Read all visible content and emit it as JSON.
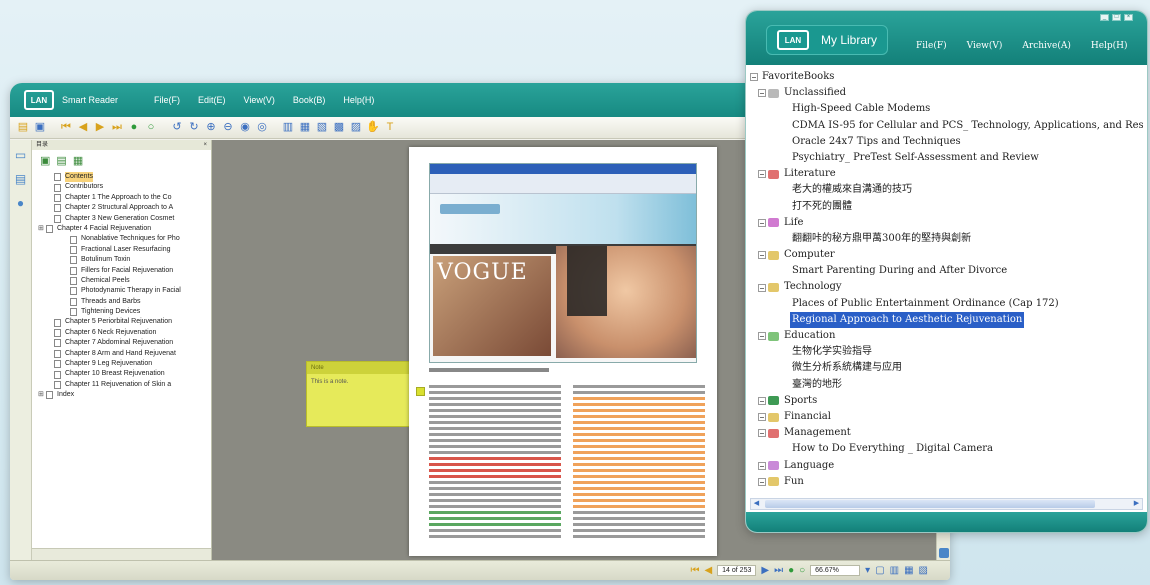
{
  "reader": {
    "app_title": "Smart Reader",
    "menus": [
      "File(F)",
      "Edit(E)",
      "View(V)",
      "Book(B)",
      "Help(H)"
    ],
    "toolbar_icons": [
      "open-icon",
      "save-icon",
      "first-page-icon",
      "prev-page-icon",
      "next-page-icon",
      "last-page-icon",
      "go-icon",
      "stop-icon",
      "rotate-left-icon",
      "rotate-right-icon",
      "zoom-in-icon",
      "zoom-out-icon",
      "zoom-fit-icon",
      "zoom-actual-icon",
      "single-page-icon",
      "two-page-icon",
      "continuous-icon",
      "print-icon",
      "bookmark-icon",
      "hand-tool-icon",
      "text-tool-icon"
    ],
    "toc_title": "目录",
    "toc": [
      {
        "label": "Contents",
        "selected": true,
        "expandable": false,
        "indent": 0
      },
      {
        "label": "Contributors",
        "selected": false,
        "expandable": false,
        "indent": 0
      },
      {
        "label": "Chapter 1 The Approach to the Co",
        "selected": false,
        "expandable": false,
        "indent": 0
      },
      {
        "label": "Chapter 2 Structural Approach to A",
        "selected": false,
        "expandable": false,
        "indent": 0
      },
      {
        "label": "Chapter 3 New Generation Cosmet",
        "selected": false,
        "expandable": false,
        "indent": 0
      },
      {
        "label": "Chapter 4 Facial Rejuvenation",
        "selected": false,
        "expandable": true,
        "indent": 0
      },
      {
        "label": "Nonablative Techniques for Pho",
        "selected": false,
        "expandable": false,
        "indent": 1
      },
      {
        "label": "Fractional Laser Resurfacing",
        "selected": false,
        "expandable": false,
        "indent": 1
      },
      {
        "label": "Botulinum Toxin",
        "selected": false,
        "expandable": false,
        "indent": 1
      },
      {
        "label": "Fillers for Facial Rejuvenation",
        "selected": false,
        "expandable": false,
        "indent": 1
      },
      {
        "label": "Chemical Peels",
        "selected": false,
        "expandable": false,
        "indent": 1
      },
      {
        "label": "Photodynamic Therapy in Facial",
        "selected": false,
        "expandable": false,
        "indent": 1
      },
      {
        "label": "Threads and Barbs",
        "selected": false,
        "expandable": false,
        "indent": 1
      },
      {
        "label": "Tightening Devices",
        "selected": false,
        "expandable": false,
        "indent": 1
      },
      {
        "label": "Chapter 5 Periorbital Rejuvenation",
        "selected": false,
        "expandable": false,
        "indent": 0
      },
      {
        "label": "Chapter 6 Neck Rejuvenation",
        "selected": false,
        "expandable": false,
        "indent": 0
      },
      {
        "label": "Chapter 7 Abdominal Rejuvenation",
        "selected": false,
        "expandable": false,
        "indent": 0
      },
      {
        "label": "Chapter 8 Arm and Hand Rejuvenat",
        "selected": false,
        "expandable": false,
        "indent": 0
      },
      {
        "label": "Chapter 9 Leg Rejuvenation",
        "selected": false,
        "expandable": false,
        "indent": 0
      },
      {
        "label": "Chapter 10 Breast Rejuvenation",
        "selected": false,
        "expandable": false,
        "indent": 0
      },
      {
        "label": "Chapter 11 Rejuvenation of Skin a",
        "selected": false,
        "expandable": false,
        "indent": 0
      },
      {
        "label": "Index",
        "selected": false,
        "expandable": true,
        "indent": 0
      }
    ],
    "note": {
      "header": "Note",
      "body": "This is a note."
    },
    "page_figure": {
      "magazine_title": "VOGUE"
    },
    "status": {
      "page": "14 of 253",
      "zoom": "66.67%"
    }
  },
  "library": {
    "title": "My Library",
    "logo": "LAN",
    "menus": [
      "File(F)",
      "View(V)",
      "Archive(A)",
      "Help(H)"
    ],
    "window_buttons": [
      "minimize",
      "maximize",
      "close"
    ],
    "tree": [
      {
        "type": "root",
        "label": "FavoriteBooks"
      },
      {
        "type": "category",
        "label": "Unclassified",
        "color": "#b9b9b9"
      },
      {
        "type": "book",
        "label": "High-Speed Cable Modems"
      },
      {
        "type": "book",
        "label": "CDMA IS-95 for Cellular and PCS_ Technology, Applications, and Resour"
      },
      {
        "type": "book",
        "label": "Oracle 24x7 Tips and Techniques"
      },
      {
        "type": "book",
        "label": "Psychiatry_ PreTest Self-Assessment and Review"
      },
      {
        "type": "category",
        "label": "Literature",
        "color": "#e07070"
      },
      {
        "type": "book",
        "label": "老大的權威來自溝通的技巧"
      },
      {
        "type": "book",
        "label": "打不死的團體"
      },
      {
        "type": "category",
        "label": "Life",
        "color": "#d07ad0"
      },
      {
        "type": "book",
        "label": "翻翻咔的秘方鼎甲萬300年的堅持與創新"
      },
      {
        "type": "category",
        "label": "Computer",
        "color": "#e3c76a"
      },
      {
        "type": "book",
        "label": "Smart Parenting During and After Divorce"
      },
      {
        "type": "category",
        "label": "Technology",
        "color": "#e3c76a"
      },
      {
        "type": "book",
        "label": "Places of Public Entertainment Ordinance (Cap 172)"
      },
      {
        "type": "book",
        "label": "Regional Approach to Aesthetic Rejuvenation",
        "selected": true
      },
      {
        "type": "category",
        "label": "Education",
        "color": "#7fc47a"
      },
      {
        "type": "book",
        "label": "生物化学实验指导"
      },
      {
        "type": "book",
        "label": "微生分析系統構建与应用"
      },
      {
        "type": "book",
        "label": "臺灣的地形"
      },
      {
        "type": "category",
        "label": "Sports",
        "color": "#3e9a54"
      },
      {
        "type": "category",
        "label": "Financial",
        "color": "#e3c76a"
      },
      {
        "type": "category",
        "label": "Management",
        "color": "#e07070"
      },
      {
        "type": "book",
        "label": "How to Do Everything _ Digital Camera"
      },
      {
        "type": "category",
        "label": "Language",
        "color": "#c98ad8"
      },
      {
        "type": "category",
        "label": "Fun",
        "color": "#e3c76a"
      }
    ]
  },
  "colors": {
    "teal": "#1a9890",
    "selection": "#2a5fc7",
    "highlight": "#f0a25a",
    "note": "#e6ea5a"
  }
}
